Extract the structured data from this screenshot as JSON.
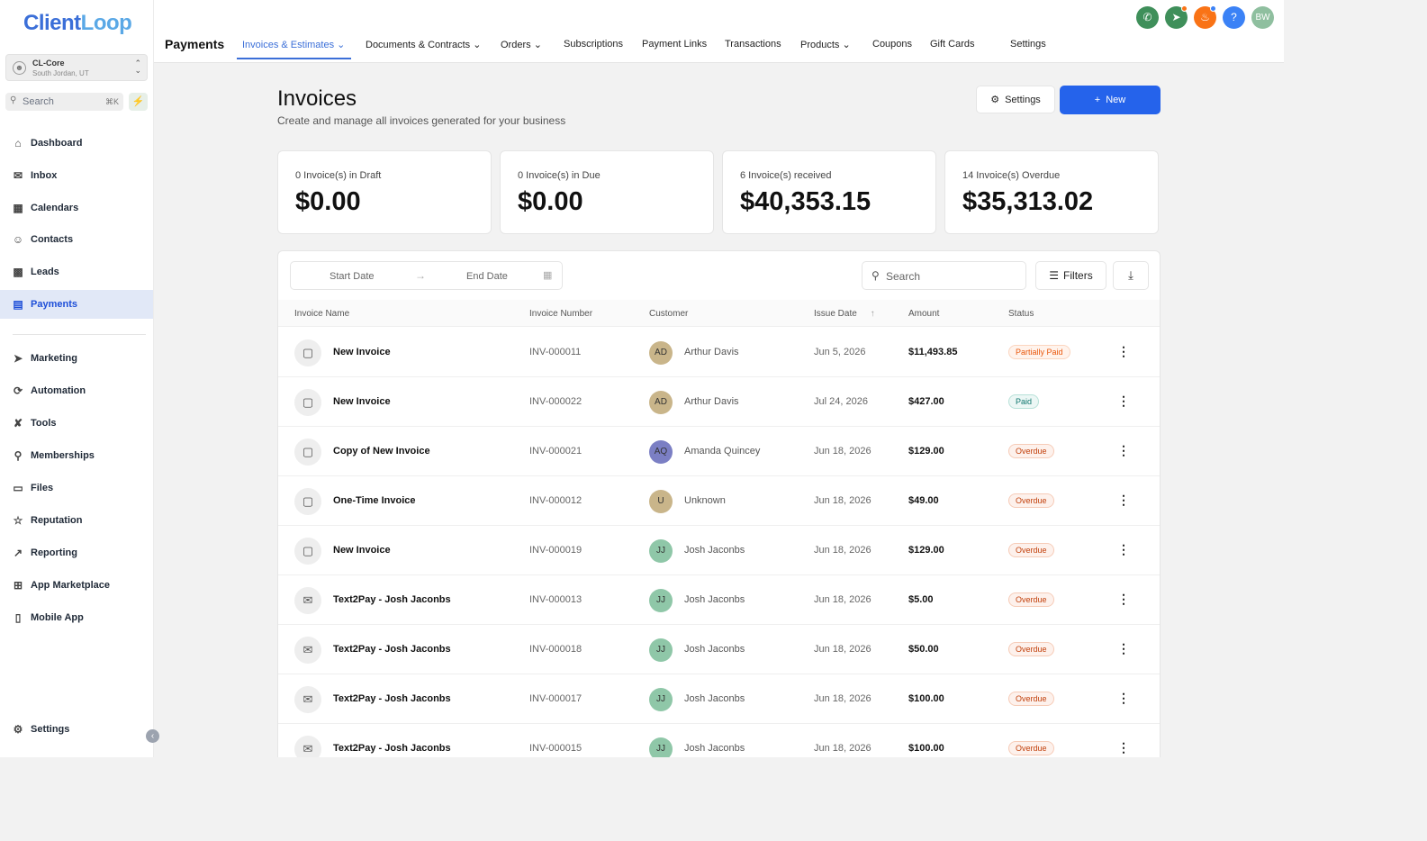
{
  "brand": {
    "part1": "Client",
    "part2": "Loop"
  },
  "account": {
    "name": "CL-Core",
    "location": "South Jordan, UT"
  },
  "sidebar_search": {
    "placeholder": "Search",
    "shortcut": "⌘K"
  },
  "sidebar": {
    "items": [
      {
        "label": "Dashboard",
        "icon": "home-icon"
      },
      {
        "label": "Inbox",
        "icon": "inbox-icon"
      },
      {
        "label": "Calendars",
        "icon": "calendar-icon"
      },
      {
        "label": "Contacts",
        "icon": "contacts-icon"
      },
      {
        "label": "Leads",
        "icon": "chart-bar-icon"
      },
      {
        "label": "Payments",
        "icon": "credit-card-icon"
      },
      {
        "label": "Marketing",
        "icon": "megaphone-icon"
      },
      {
        "label": "Automation",
        "icon": "automation-icon"
      },
      {
        "label": "Tools",
        "icon": "tools-icon"
      },
      {
        "label": "Memberships",
        "icon": "membership-icon"
      },
      {
        "label": "Files",
        "icon": "folder-icon"
      },
      {
        "label": "Reputation",
        "icon": "star-icon"
      },
      {
        "label": "Reporting",
        "icon": "trend-icon"
      },
      {
        "label": "App Marketplace",
        "icon": "grid-icon"
      },
      {
        "label": "Mobile App",
        "icon": "phone-device-icon"
      }
    ],
    "settings": "Settings"
  },
  "header": {
    "title": "Payments",
    "tabs": [
      {
        "label": "Invoices & Estimates",
        "dropdown": true
      },
      {
        "label": "Documents & Contracts",
        "dropdown": true
      },
      {
        "label": "Orders",
        "dropdown": true
      },
      {
        "label": "Subscriptions",
        "dropdown": false
      },
      {
        "label": "Payment Links",
        "dropdown": false
      },
      {
        "label": "Transactions",
        "dropdown": false
      },
      {
        "label": "Products",
        "dropdown": true
      },
      {
        "label": "Coupons",
        "dropdown": false
      },
      {
        "label": "Gift Cards",
        "dropdown": false
      },
      {
        "label": "Settings",
        "dropdown": false
      }
    ],
    "avatar_initials": "BW",
    "help_glyph": "?"
  },
  "page": {
    "title": "Invoices",
    "subtitle": "Create and manage all invoices generated for your business",
    "settings_label": "Settings",
    "new_label": "New"
  },
  "stats": [
    {
      "label": "0 Invoice(s) in Draft",
      "value": "$0.00"
    },
    {
      "label": "0 Invoice(s) in Due",
      "value": "$0.00"
    },
    {
      "label": "6 Invoice(s) received",
      "value": "$40,353.15"
    },
    {
      "label": "14 Invoice(s) Overdue",
      "value": "$35,313.02"
    }
  ],
  "table": {
    "start_date_placeholder": "Start Date",
    "end_date_placeholder": "End Date",
    "search_placeholder": "Search",
    "filters_label": "Filters",
    "columns": [
      "Invoice Name",
      "Invoice Number",
      "Customer",
      "Issue Date",
      "Amount",
      "Status"
    ],
    "rows": [
      {
        "name": "New Invoice",
        "number": "INV-000011",
        "initials": "AD",
        "customer": "Arthur Davis",
        "date": "Jun 5, 2026",
        "amount": "$11,493.85",
        "status": "Partially Paid",
        "type": "document"
      },
      {
        "name": "New Invoice",
        "number": "INV-000022",
        "initials": "AD",
        "customer": "Arthur Davis",
        "date": "Jul 24, 2026",
        "amount": "$427.00",
        "status": "Paid",
        "type": "document"
      },
      {
        "name": "Copy of New Invoice",
        "number": "INV-000021",
        "initials": "AQ",
        "customer": "Amanda Quincey",
        "date": "Jun 18, 2026",
        "amount": "$129.00",
        "status": "Overdue",
        "type": "document"
      },
      {
        "name": "One-Time Invoice",
        "number": "INV-000012",
        "initials": "U",
        "customer": "Unknown",
        "date": "Jun 18, 2026",
        "amount": "$49.00",
        "status": "Overdue",
        "type": "document"
      },
      {
        "name": "New Invoice",
        "number": "INV-000019",
        "initials": "JJ",
        "customer": "Josh Jaconbs",
        "date": "Jun 18, 2026",
        "amount": "$129.00",
        "status": "Overdue",
        "type": "document"
      },
      {
        "name": "Text2Pay - Josh Jaconbs",
        "number": "INV-000013",
        "initials": "JJ",
        "customer": "Josh Jaconbs",
        "date": "Jun 18, 2026",
        "amount": "$5.00",
        "status": "Overdue",
        "type": "text2pay"
      },
      {
        "name": "Text2Pay - Josh Jaconbs",
        "number": "INV-000018",
        "initials": "JJ",
        "customer": "Josh Jaconbs",
        "date": "Jun 18, 2026",
        "amount": "$50.00",
        "status": "Overdue",
        "type": "text2pay"
      },
      {
        "name": "Text2Pay - Josh Jaconbs",
        "number": "INV-000017",
        "initials": "JJ",
        "customer": "Josh Jaconbs",
        "date": "Jun 18, 2026",
        "amount": "$100.00",
        "status": "Overdue",
        "type": "text2pay"
      },
      {
        "name": "Text2Pay - Josh Jaconbs",
        "number": "INV-000015",
        "initials": "JJ",
        "customer": "Josh Jaconbs",
        "date": "Jun 18, 2026",
        "amount": "$100.00",
        "status": "Overdue",
        "type": "text2pay"
      }
    ]
  },
  "colors": {
    "accent": "#2563eb",
    "active_nav_bg": "#e1e8f7",
    "overdue": "#c2410c",
    "paid": "#0f766e",
    "partial": "#ea580c"
  }
}
